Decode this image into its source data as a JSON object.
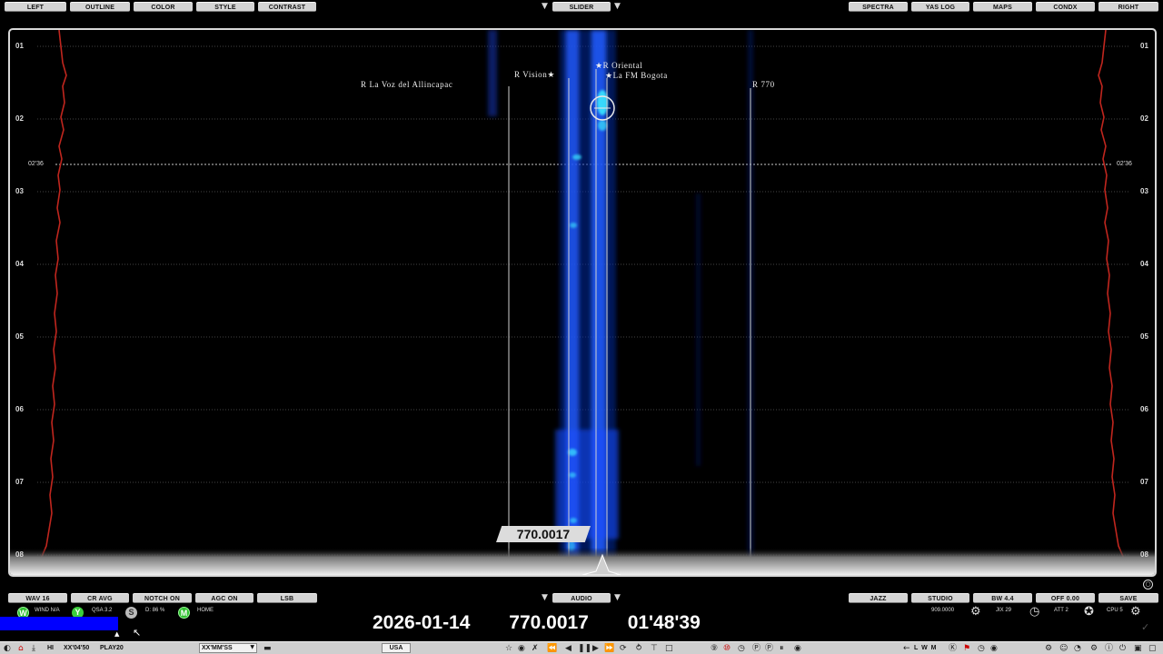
{
  "top_buttons_left": [
    "LEFT",
    "OUTLINE",
    "COLOR",
    "STYLE",
    "CONTRAST"
  ],
  "top_center_button": "SLIDER",
  "top_buttons_right": [
    "SPECTRA",
    "YAS LOG",
    "MAPS",
    "CONDX",
    "RIGHT"
  ],
  "bottom_buttons_left": [
    "WAV 16",
    "CR AVG",
    "NOTCH ON",
    "AGC ON",
    "LSB"
  ],
  "bottom_center_button": "AUDIO",
  "bottom_buttons_right": [
    "JAZZ",
    "STUDIO",
    "BW 4.4",
    "OFF 0.00",
    "SAVE"
  ],
  "waterfall": {
    "time_ticks": [
      "01",
      "02",
      "03",
      "04",
      "05",
      "06",
      "07",
      "08"
    ],
    "marker_time": "02'36",
    "stations": [
      {
        "label": "R La Voz del Allincapac"
      },
      {
        "label": "R Vision★"
      },
      {
        "label": "★R Oriental"
      },
      {
        "label": "★La FM Bogota"
      },
      {
        "label": "R 770"
      }
    ],
    "cursor_frequency": "770.0017"
  },
  "status_left": {
    "wind": "WIND N/A",
    "qsa": "QSA 3.2",
    "d": "D: 86 %",
    "home": "HOME",
    "w_badge": "W",
    "y_badge": "Y",
    "s_badge": "S",
    "m_badge": "M"
  },
  "status_right": {
    "freq": "909.0000",
    "jix": "JIX 29",
    "att": "ATT 2",
    "cpu": "CPU 5"
  },
  "readout": {
    "date": "2026-01-14",
    "frequency": "770.0017",
    "time": "01'48'39"
  },
  "bottom_bar": {
    "hi": "HI",
    "offset": "XX'04'50",
    "play": "PLAY20",
    "time_format": "XX'MM'SS",
    "region": "USA",
    "letters": "L W M"
  },
  "colors": {
    "signal_blue": "#1f5cff",
    "signal_cyan": "#3ce8ff",
    "edge_red": "#c0261e",
    "progress_blue": "#0000ff"
  }
}
